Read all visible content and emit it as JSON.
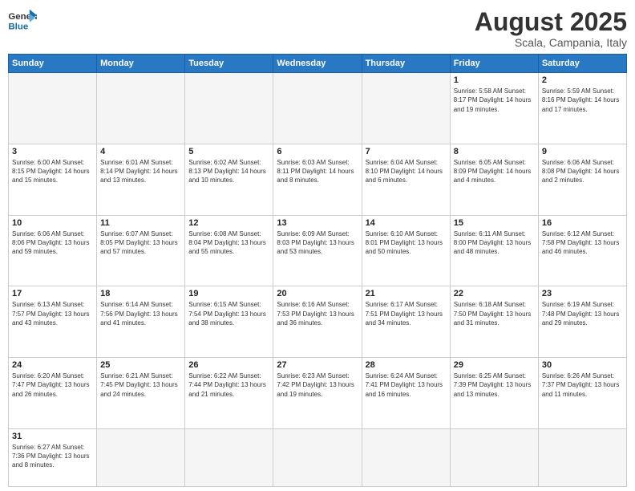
{
  "header": {
    "logo_general": "General",
    "logo_blue": "Blue",
    "title": "August 2025",
    "subtitle": "Scala, Campania, Italy"
  },
  "weekdays": [
    "Sunday",
    "Monday",
    "Tuesday",
    "Wednesday",
    "Thursday",
    "Friday",
    "Saturday"
  ],
  "weeks": [
    [
      {
        "day": "",
        "info": ""
      },
      {
        "day": "",
        "info": ""
      },
      {
        "day": "",
        "info": ""
      },
      {
        "day": "",
        "info": ""
      },
      {
        "day": "",
        "info": ""
      },
      {
        "day": "1",
        "info": "Sunrise: 5:58 AM\nSunset: 8:17 PM\nDaylight: 14 hours and 19 minutes."
      },
      {
        "day": "2",
        "info": "Sunrise: 5:59 AM\nSunset: 8:16 PM\nDaylight: 14 hours and 17 minutes."
      }
    ],
    [
      {
        "day": "3",
        "info": "Sunrise: 6:00 AM\nSunset: 8:15 PM\nDaylight: 14 hours and 15 minutes."
      },
      {
        "day": "4",
        "info": "Sunrise: 6:01 AM\nSunset: 8:14 PM\nDaylight: 14 hours and 13 minutes."
      },
      {
        "day": "5",
        "info": "Sunrise: 6:02 AM\nSunset: 8:13 PM\nDaylight: 14 hours and 10 minutes."
      },
      {
        "day": "6",
        "info": "Sunrise: 6:03 AM\nSunset: 8:11 PM\nDaylight: 14 hours and 8 minutes."
      },
      {
        "day": "7",
        "info": "Sunrise: 6:04 AM\nSunset: 8:10 PM\nDaylight: 14 hours and 6 minutes."
      },
      {
        "day": "8",
        "info": "Sunrise: 6:05 AM\nSunset: 8:09 PM\nDaylight: 14 hours and 4 minutes."
      },
      {
        "day": "9",
        "info": "Sunrise: 6:06 AM\nSunset: 8:08 PM\nDaylight: 14 hours and 2 minutes."
      }
    ],
    [
      {
        "day": "10",
        "info": "Sunrise: 6:06 AM\nSunset: 8:06 PM\nDaylight: 13 hours and 59 minutes."
      },
      {
        "day": "11",
        "info": "Sunrise: 6:07 AM\nSunset: 8:05 PM\nDaylight: 13 hours and 57 minutes."
      },
      {
        "day": "12",
        "info": "Sunrise: 6:08 AM\nSunset: 8:04 PM\nDaylight: 13 hours and 55 minutes."
      },
      {
        "day": "13",
        "info": "Sunrise: 6:09 AM\nSunset: 8:03 PM\nDaylight: 13 hours and 53 minutes."
      },
      {
        "day": "14",
        "info": "Sunrise: 6:10 AM\nSunset: 8:01 PM\nDaylight: 13 hours and 50 minutes."
      },
      {
        "day": "15",
        "info": "Sunrise: 6:11 AM\nSunset: 8:00 PM\nDaylight: 13 hours and 48 minutes."
      },
      {
        "day": "16",
        "info": "Sunrise: 6:12 AM\nSunset: 7:58 PM\nDaylight: 13 hours and 46 minutes."
      }
    ],
    [
      {
        "day": "17",
        "info": "Sunrise: 6:13 AM\nSunset: 7:57 PM\nDaylight: 13 hours and 43 minutes."
      },
      {
        "day": "18",
        "info": "Sunrise: 6:14 AM\nSunset: 7:56 PM\nDaylight: 13 hours and 41 minutes."
      },
      {
        "day": "19",
        "info": "Sunrise: 6:15 AM\nSunset: 7:54 PM\nDaylight: 13 hours and 38 minutes."
      },
      {
        "day": "20",
        "info": "Sunrise: 6:16 AM\nSunset: 7:53 PM\nDaylight: 13 hours and 36 minutes."
      },
      {
        "day": "21",
        "info": "Sunrise: 6:17 AM\nSunset: 7:51 PM\nDaylight: 13 hours and 34 minutes."
      },
      {
        "day": "22",
        "info": "Sunrise: 6:18 AM\nSunset: 7:50 PM\nDaylight: 13 hours and 31 minutes."
      },
      {
        "day": "23",
        "info": "Sunrise: 6:19 AM\nSunset: 7:48 PM\nDaylight: 13 hours and 29 minutes."
      }
    ],
    [
      {
        "day": "24",
        "info": "Sunrise: 6:20 AM\nSunset: 7:47 PM\nDaylight: 13 hours and 26 minutes."
      },
      {
        "day": "25",
        "info": "Sunrise: 6:21 AM\nSunset: 7:45 PM\nDaylight: 13 hours and 24 minutes."
      },
      {
        "day": "26",
        "info": "Sunrise: 6:22 AM\nSunset: 7:44 PM\nDaylight: 13 hours and 21 minutes."
      },
      {
        "day": "27",
        "info": "Sunrise: 6:23 AM\nSunset: 7:42 PM\nDaylight: 13 hours and 19 minutes."
      },
      {
        "day": "28",
        "info": "Sunrise: 6:24 AM\nSunset: 7:41 PM\nDaylight: 13 hours and 16 minutes."
      },
      {
        "day": "29",
        "info": "Sunrise: 6:25 AM\nSunset: 7:39 PM\nDaylight: 13 hours and 13 minutes."
      },
      {
        "day": "30",
        "info": "Sunrise: 6:26 AM\nSunset: 7:37 PM\nDaylight: 13 hours and 11 minutes."
      }
    ],
    [
      {
        "day": "31",
        "info": "Sunrise: 6:27 AM\nSunset: 7:36 PM\nDaylight: 13 hours and 8 minutes."
      },
      {
        "day": "",
        "info": ""
      },
      {
        "day": "",
        "info": ""
      },
      {
        "day": "",
        "info": ""
      },
      {
        "day": "",
        "info": ""
      },
      {
        "day": "",
        "info": ""
      },
      {
        "day": "",
        "info": ""
      }
    ]
  ]
}
